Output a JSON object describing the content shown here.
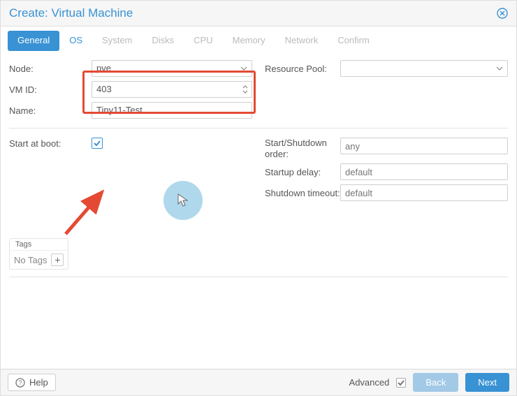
{
  "window_title": "Create: Virtual Machine",
  "tabs": {
    "general": "General",
    "os": "OS",
    "system": "System",
    "disks": "Disks",
    "cpu": "CPU",
    "memory": "Memory",
    "network": "Network",
    "confirm": "Confirm"
  },
  "fields": {
    "node_label": "Node:",
    "node_value": "pve",
    "vmid_label": "VM ID:",
    "vmid_value": "403",
    "name_label": "Name:",
    "name_value": "Tiny11-Test",
    "start_at_boot_label": "Start at boot:",
    "resource_pool_label": "Resource Pool:",
    "resource_pool_value": "",
    "start_shutdown_label": "Start/Shutdown order:",
    "start_shutdown_placeholder": "any",
    "startup_delay_label": "Startup delay:",
    "startup_delay_placeholder": "default",
    "shutdown_timeout_label": "Shutdown timeout:",
    "shutdown_timeout_placeholder": "default"
  },
  "tags": {
    "header": "Tags",
    "empty": "No Tags"
  },
  "footer": {
    "help": "Help",
    "advanced": "Advanced",
    "back": "Back",
    "next": "Next"
  }
}
